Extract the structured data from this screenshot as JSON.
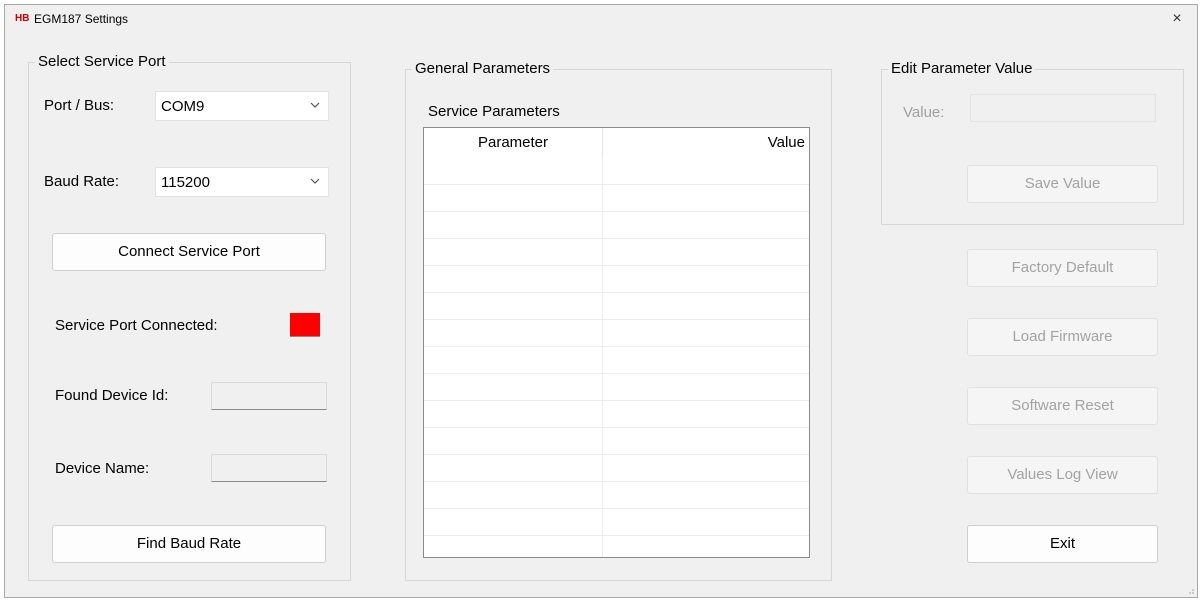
{
  "window": {
    "logo": "HB",
    "title": "EGM187 Settings",
    "close_glyph": "×"
  },
  "service_port": {
    "group_title": "Select Service Port",
    "port_label": "Port / Bus:",
    "port_value": "COM9",
    "baud_label": "Baud Rate:",
    "baud_value": "115200",
    "connect_button": "Connect Service Port",
    "connected_label": "Service Port Connected:",
    "connected_status_color": "#ff0000",
    "device_id_label": "Found Device Id:",
    "device_id_value": "",
    "device_name_label": "Device Name:",
    "device_name_value": "",
    "find_baud_button": "Find Baud Rate"
  },
  "general": {
    "group_title": "General Parameters",
    "service_params_label": "Service Parameters",
    "columns": [
      "Parameter",
      "Value"
    ],
    "rows": [
      [
        "",
        ""
      ],
      [
        "",
        ""
      ],
      [
        "",
        ""
      ],
      [
        "",
        ""
      ],
      [
        "",
        ""
      ],
      [
        "",
        ""
      ],
      [
        "",
        ""
      ],
      [
        "",
        ""
      ],
      [
        "",
        ""
      ],
      [
        "",
        ""
      ],
      [
        "",
        ""
      ],
      [
        "",
        ""
      ],
      [
        "",
        ""
      ],
      [
        "",
        ""
      ],
      [
        "",
        ""
      ]
    ]
  },
  "edit": {
    "group_title": "Edit Parameter Value",
    "value_label": "Value:",
    "value_text": "",
    "save_button": "Save Value"
  },
  "actions": {
    "factory_default": "Factory Default",
    "load_firmware": "Load Firmware",
    "software_reset": "Software Reset",
    "values_log_view": "Values Log View",
    "exit": "Exit"
  },
  "icons": {
    "chevron": "chevron-down-icon",
    "close": "close-icon",
    "grip": "resize-grip-icon"
  }
}
